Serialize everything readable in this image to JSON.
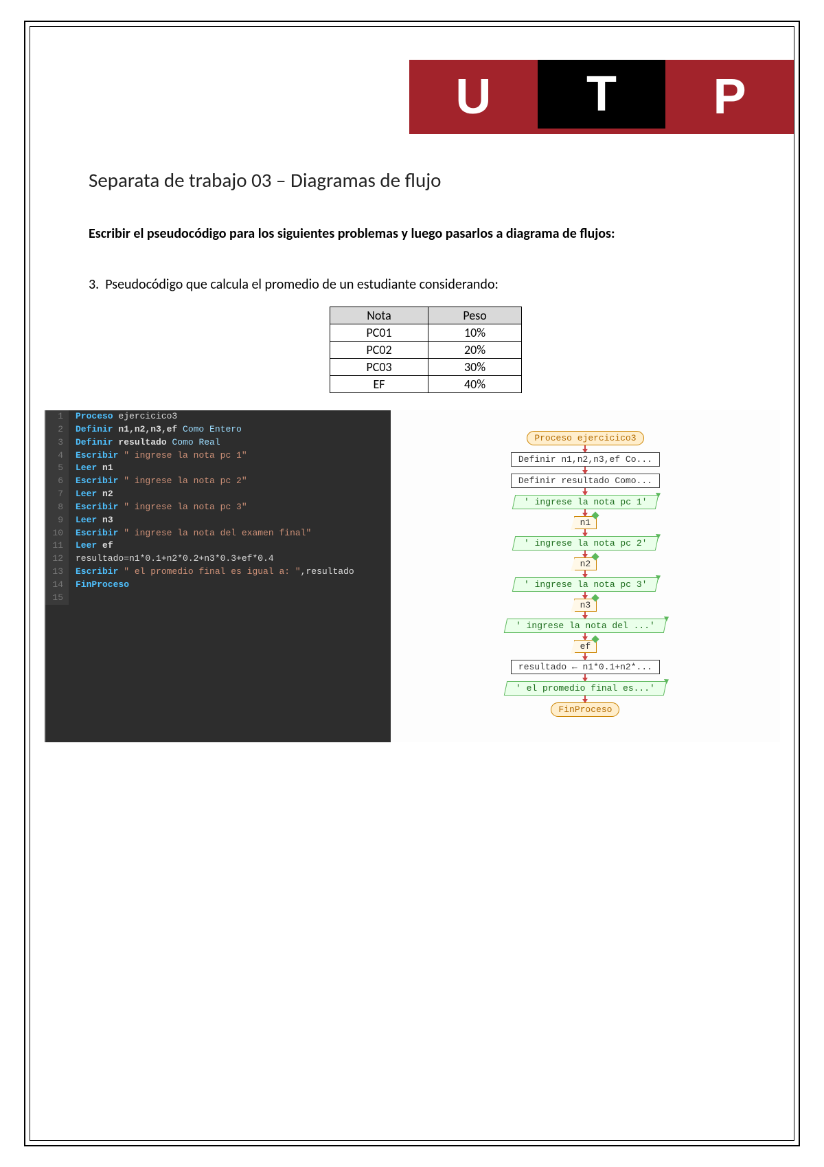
{
  "logo": {
    "l1": "U",
    "l2": "T",
    "l3": "P"
  },
  "title": "Separata de trabajo 03 – Diagramas de flujo",
  "subtitle": "Escribir el pseudocódigo para los siguientes problemas y luego pasarlos a diagrama de flujos:",
  "question_num": "3.",
  "question": "Pseudocódigo que calcula el promedio de un estudiante considerando:",
  "table": {
    "h1": "Nota",
    "h2": "Peso",
    "r1c1": "PC01",
    "r1c2": "10%",
    "r2c1": "PC02",
    "r2c2": "20%",
    "r3c1": "PC03",
    "r3c2": "30%",
    "r4c1": "EF",
    "r4c2": "40%"
  },
  "code": {
    "l1_kw": "Proceso",
    "l1_rest": " ejercicico3",
    "l2_kw": "Definir",
    "l2_vars": " n1,n2,n3,ef ",
    "l2_como": "Como Entero",
    "l3_kw": "Definir",
    "l3_vars": " resultado ",
    "l3_como": "Como Real",
    "l4_kw": "Escribir",
    "l4_str": " \" ingrese la nota pc 1\"",
    "l5_kw": "Leer",
    "l5_vars": " n1",
    "l6_kw": "Escribir",
    "l6_str": " \" ingrese la nota pc 2\"",
    "l7_kw": "Leer",
    "l7_vars": " n2",
    "l8_kw": "Escribir",
    "l8_str": " \" ingrese la nota pc 3\"",
    "l9_kw": "Leer",
    "l9_vars": " n3",
    "l10_kw": "Escribir",
    "l10_str": " \" ingrese la nota del examen final\"",
    "l11_kw": "Leer",
    "l11_vars": " ef",
    "l12": "resultado=n1*0.1+n2*0.2+n3*0.3+ef*0.4",
    "l13_kw": "Escribir",
    "l13_str": " \" el promedio final es igual a: \"",
    "l13_rest": ",resultado",
    "l14_kw": "FinProceso"
  },
  "flow": {
    "n1": "Proceso ejercicico3",
    "n2": "Definir n1,n2,n3,ef Co...",
    "n3": "Definir resultado Como...",
    "n4": "' ingrese la nota pc 1'",
    "n5": "n1",
    "n6": "' ingrese la nota pc 2'",
    "n7": "n2",
    "n8": "' ingrese la nota pc 3'",
    "n9": "n3",
    "n10": "' ingrese la nota del ...'",
    "n11": "ef",
    "n12": "resultado ← n1*0.1+n2*...",
    "n13": "' el promedio final es...'",
    "n14": "FinProceso"
  },
  "line_numbers": {
    "1": "1",
    "2": "2",
    "3": "3",
    "4": "4",
    "5": "5",
    "6": "6",
    "7": "7",
    "8": "8",
    "9": "9",
    "10": "10",
    "11": "11",
    "12": "12",
    "13": "13",
    "14": "14",
    "15": "15"
  }
}
